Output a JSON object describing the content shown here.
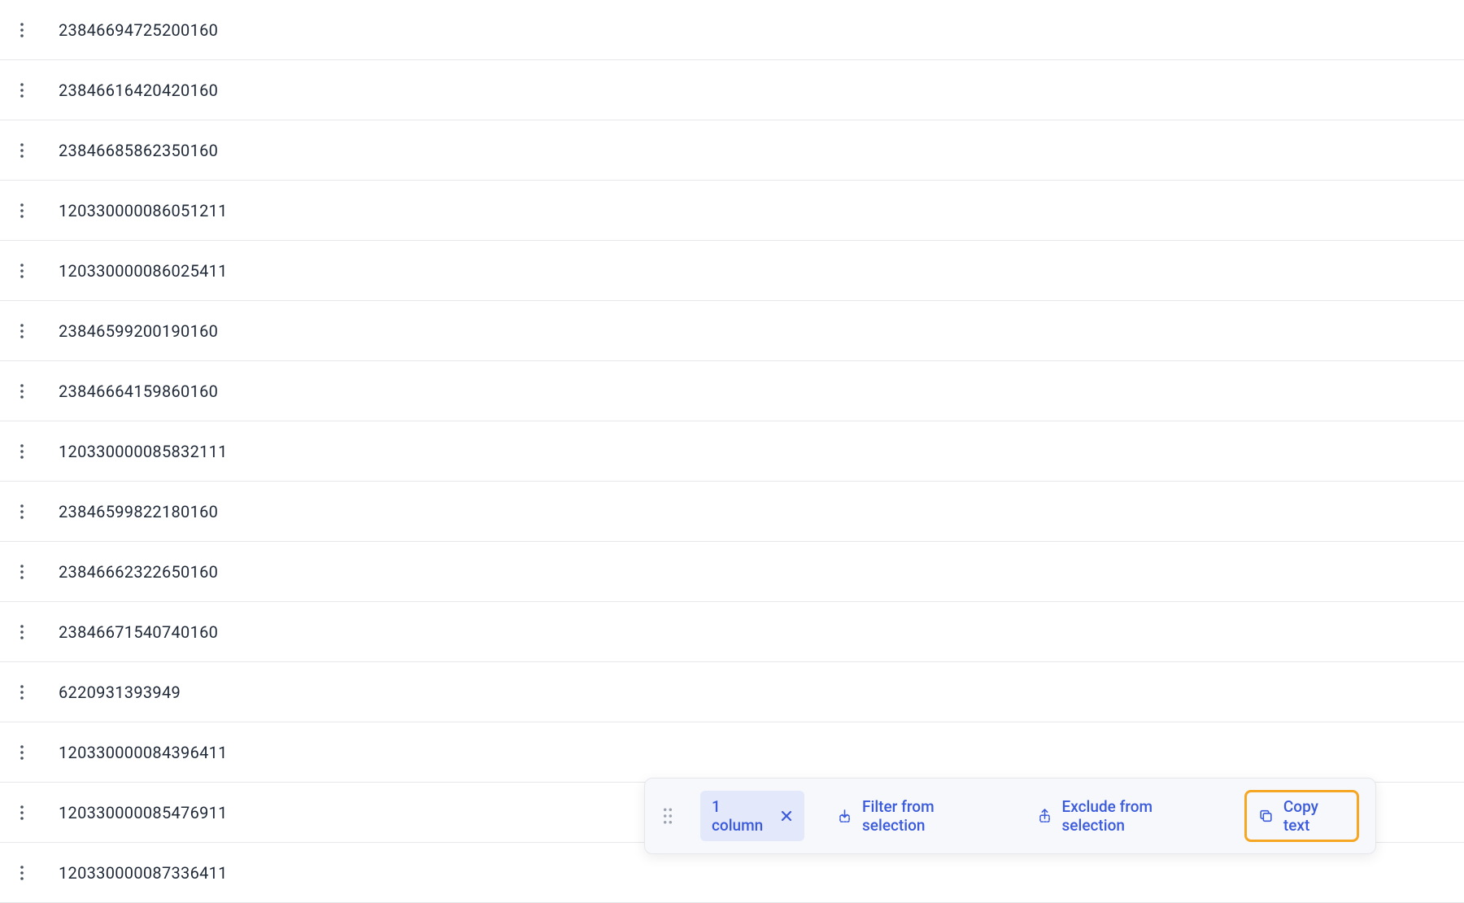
{
  "rows": [
    {
      "value": "23846694725200160"
    },
    {
      "value": "23846616420420160"
    },
    {
      "value": "23846685862350160"
    },
    {
      "value": "120330000086051211"
    },
    {
      "value": "120330000086025411"
    },
    {
      "value": "23846599200190160"
    },
    {
      "value": "23846664159860160"
    },
    {
      "value": "120330000085832111"
    },
    {
      "value": "23846599822180160"
    },
    {
      "value": "23846662322650160"
    },
    {
      "value": "23846671540740160"
    },
    {
      "value": "6220931393949"
    },
    {
      "value": "120330000084396411"
    },
    {
      "value": "120330000085476911"
    },
    {
      "value": "120330000087336411"
    }
  ],
  "toolbar": {
    "selection_label": "1 column",
    "filter_label": "Filter from selection",
    "exclude_label": "Exclude from selection",
    "copy_label": "Copy text"
  }
}
